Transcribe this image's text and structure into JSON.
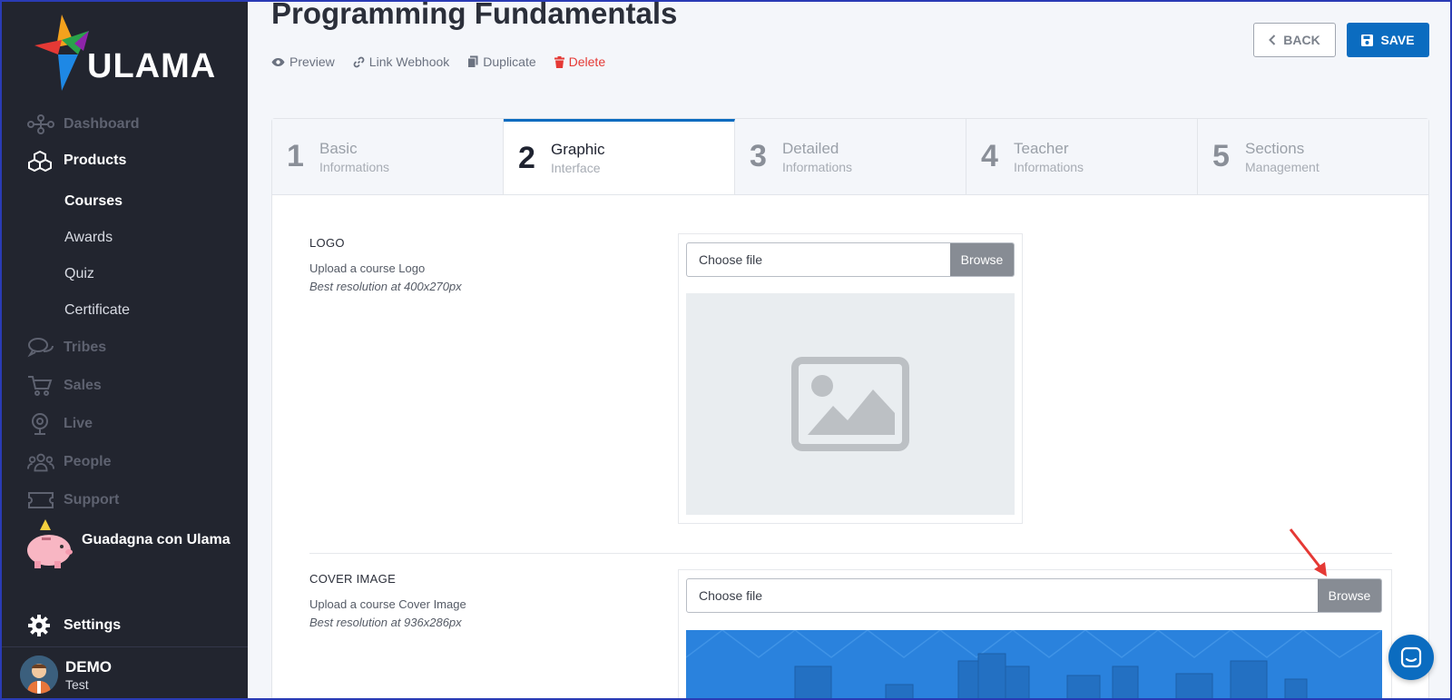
{
  "app": {
    "logo_text": "ULAMA"
  },
  "sidebar": {
    "items": [
      {
        "label": "Dashboard",
        "icon": "network-icon"
      },
      {
        "label": "Products",
        "icon": "cubes-icon"
      },
      {
        "label": "Tribes",
        "icon": "chat-bubbles-icon"
      },
      {
        "label": "Sales",
        "icon": "cart-icon"
      },
      {
        "label": "Live",
        "icon": "webcam-icon"
      },
      {
        "label": "People",
        "icon": "people-icon"
      },
      {
        "label": "Support",
        "icon": "ticket-icon"
      }
    ],
    "sub_items": [
      "Courses",
      "Awards",
      "Quiz",
      "Certificate"
    ],
    "promo_label": "Guadagna con Ulama",
    "settings_label": "Settings",
    "user": {
      "name": "DEMO",
      "role": "Test"
    }
  },
  "header": {
    "title": "Programming Fundamentals",
    "actions": {
      "preview": "Preview",
      "webhook": "Link Webhook",
      "duplicate": "Duplicate",
      "delete": "Delete"
    },
    "back_label": "BACK",
    "save_label": "SAVE"
  },
  "tabs": [
    {
      "num": "1",
      "title": "Basic",
      "sub": "Informations"
    },
    {
      "num": "2",
      "title": "Graphic",
      "sub": "Interface"
    },
    {
      "num": "3",
      "title": "Detailed",
      "sub": "Informations"
    },
    {
      "num": "4",
      "title": "Teacher",
      "sub": "Informations"
    },
    {
      "num": "5",
      "title": "Sections",
      "sub": "Management"
    }
  ],
  "logo_section": {
    "label": "LOGO",
    "desc": "Upload a course Logo",
    "hint": "Best resolution at 400x270px",
    "placeholder": "Choose file",
    "browse": "Browse"
  },
  "cover_section": {
    "label": "COVER IMAGE",
    "desc": "Upload a course Cover Image",
    "hint": "Best resolution at 936x286px",
    "placeholder": "Choose file",
    "browse": "Browse"
  },
  "colors": {
    "sidebar": "#22252f",
    "accent": "#0b6cc0",
    "delete": "#e53935",
    "arrow": "#e53935"
  }
}
